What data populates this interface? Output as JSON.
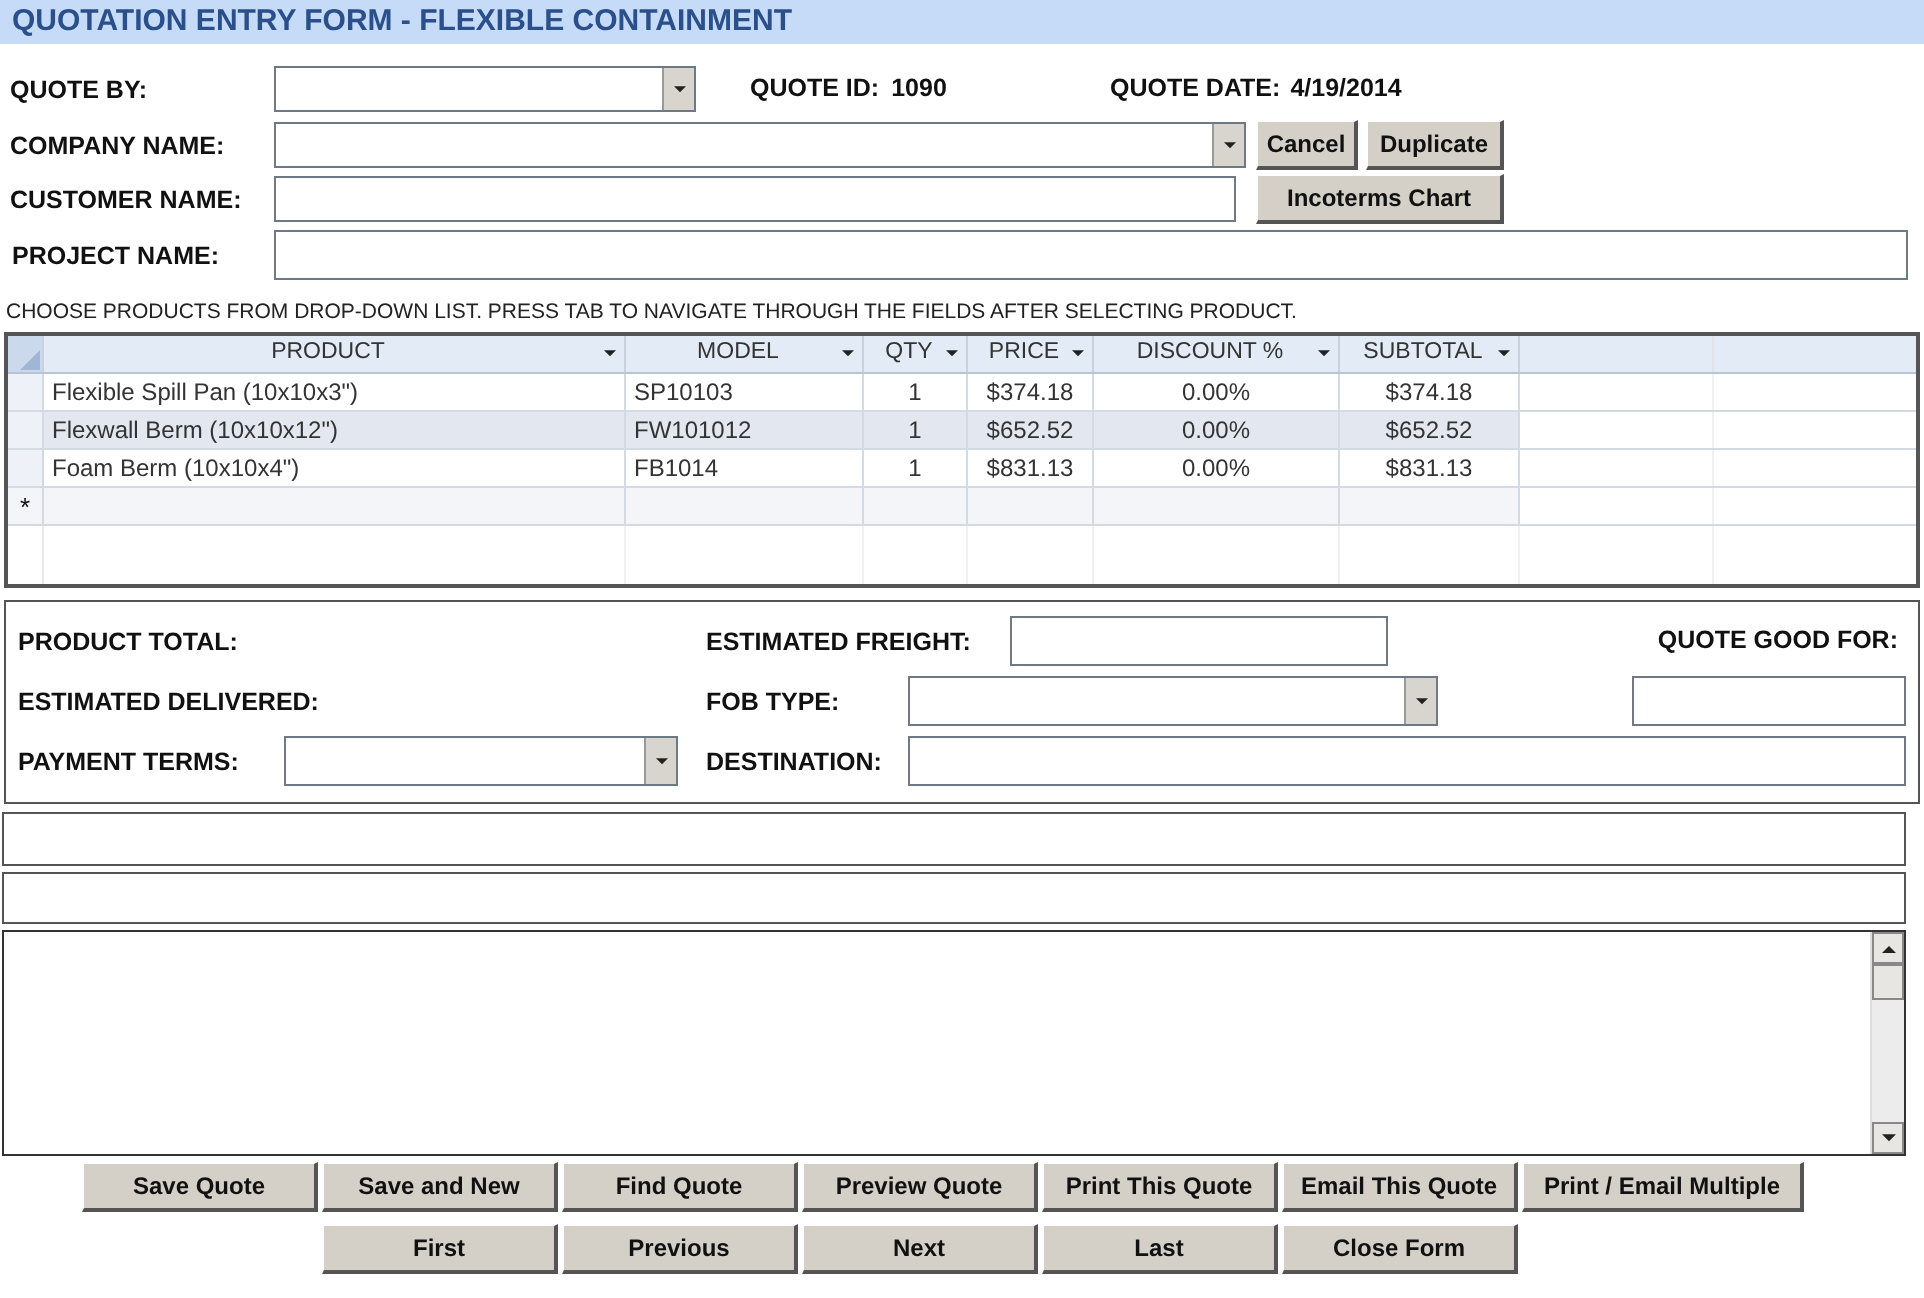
{
  "window": {
    "title": "QUOTATION ENTRY FORM - FLEXIBLE CONTAINMENT"
  },
  "header": {
    "quote_by": {
      "label": "QUOTE BY:",
      "kind": "combo"
    },
    "quote_id": {
      "label": "QUOTE ID:",
      "value": "1090"
    },
    "quote_date": {
      "label": "QUOTE DATE:",
      "value": "4/19/2014"
    },
    "company_name": {
      "label": "COMPANY NAME:",
      "kind": "combo"
    },
    "customer_name": {
      "label": "CUSTOMER NAME:",
      "kind": "text"
    },
    "project_name": {
      "label": "PROJECT NAME:",
      "kind": "text"
    },
    "buttons": [
      "Cancel",
      "Duplicate",
      "Incoterms Chart"
    ]
  },
  "instruction": "CHOOSE PRODUCTS FROM DROP-DOWN LIST. PRESS TAB TO NAVIGATE THROUGH THE FIELDS AFTER SELECTING PRODUCT.",
  "table": {
    "columns": [
      {
        "label": "PRODUCT"
      },
      {
        "label": "MODEL"
      },
      {
        "label": "QTY"
      },
      {
        "label": "PRICE"
      },
      {
        "label": "DISCOUNT %"
      },
      {
        "label": "SUBTOTAL"
      }
    ],
    "rows": [
      {
        "selected": false,
        "cells": [
          "Flexible Spill Pan (10x10x3\")",
          "SP10103",
          "1",
          "$374.18",
          "0.00%",
          "$374.18"
        ]
      },
      {
        "selected": true,
        "cells": [
          "Flexwall Berm (10x10x12\")",
          "FW101012",
          "1",
          "$652.52",
          "0.00%",
          "$652.52"
        ]
      },
      {
        "selected": false,
        "cells": [
          "Foam Berm (10x10x4\")",
          "FB1014",
          "1",
          "$831.13",
          "0.00%",
          "$831.13"
        ]
      }
    ],
    "new_row_marker": "*"
  },
  "summary": {
    "product_total": "PRODUCT TOTAL:",
    "estimated_freight": "ESTIMATED FREIGHT:",
    "quote_good_for": "QUOTE GOOD FOR:",
    "estimated_delivered": "ESTIMATED DELIVERED:",
    "fob_type": "FOB TYPE:",
    "payment_terms": "PAYMENT TERMS:",
    "destination": "DESTINATION:"
  },
  "buttons": [
    [
      "Save Quote",
      "Save and New",
      "Find Quote",
      "Preview Quote",
      "Print This Quote",
      "Email This Quote",
      "Print / Email Multiple"
    ],
    [
      "First",
      "Previous",
      "Next",
      "Last",
      "Close Form"
    ]
  ]
}
